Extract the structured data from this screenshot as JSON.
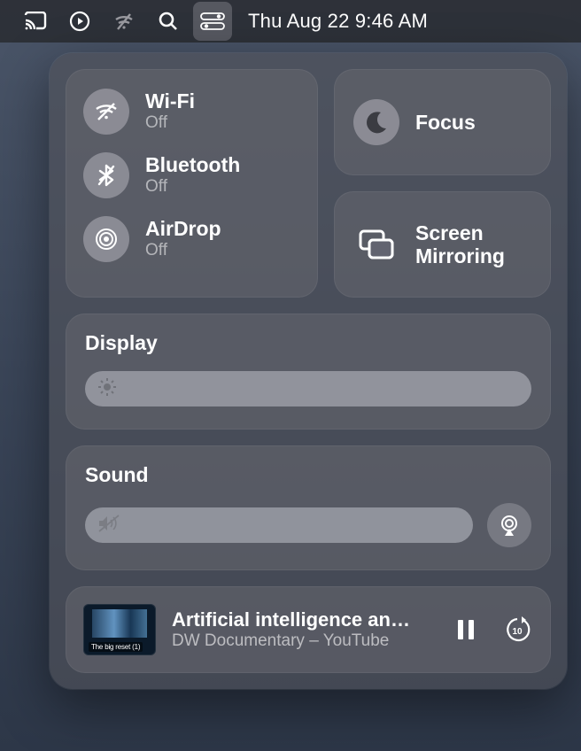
{
  "menubar": {
    "datetime": "Thu Aug 22  9:46 AM"
  },
  "connectivity": {
    "wifi": {
      "label": "Wi-Fi",
      "status": "Off"
    },
    "bluetooth": {
      "label": "Bluetooth",
      "status": "Off"
    },
    "airdrop": {
      "label": "AirDrop",
      "status": "Off"
    }
  },
  "focus": {
    "label": "Focus"
  },
  "screen_mirroring": {
    "line1": "Screen",
    "line2": "Mirroring"
  },
  "display": {
    "label": "Display"
  },
  "sound": {
    "label": "Sound"
  },
  "now_playing": {
    "title": "Artificial intelligence an…",
    "subtitle": "DW Documentary – YouTube",
    "thumb_caption": "The big reset (1)"
  }
}
